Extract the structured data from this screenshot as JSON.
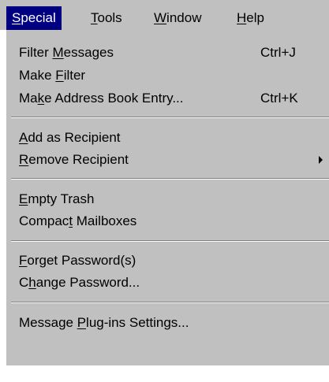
{
  "menubar": {
    "items": [
      {
        "label": "Special"
      },
      {
        "label": "Tools"
      },
      {
        "label": "Window"
      },
      {
        "label": "Help"
      }
    ]
  },
  "dropdown": {
    "filter_messages": {
      "label": "Filter Messages",
      "shortcut": "Ctrl+J"
    },
    "make_filter": {
      "label": "Make Filter"
    },
    "make_address_book_entry": {
      "label": "Make Address Book Entry...",
      "shortcut": "Ctrl+K"
    },
    "add_as_recipient": {
      "label": "Add as Recipient"
    },
    "remove_recipient": {
      "label": "Remove Recipient",
      "submenu_icon": "submenu-arrow-icon"
    },
    "empty_trash": {
      "label": "Empty Trash"
    },
    "compact_mailboxes": {
      "label": "Compact Mailboxes"
    },
    "forget_passwords": {
      "label": "Forget Password(s)"
    },
    "change_password": {
      "label": "Change Password..."
    },
    "message_plugins_settings": {
      "label": "Message Plug-ins Settings..."
    }
  },
  "colors": {
    "menu_background": "#c0c0c0",
    "highlight": "#000080",
    "highlight_text": "#ffffff"
  }
}
